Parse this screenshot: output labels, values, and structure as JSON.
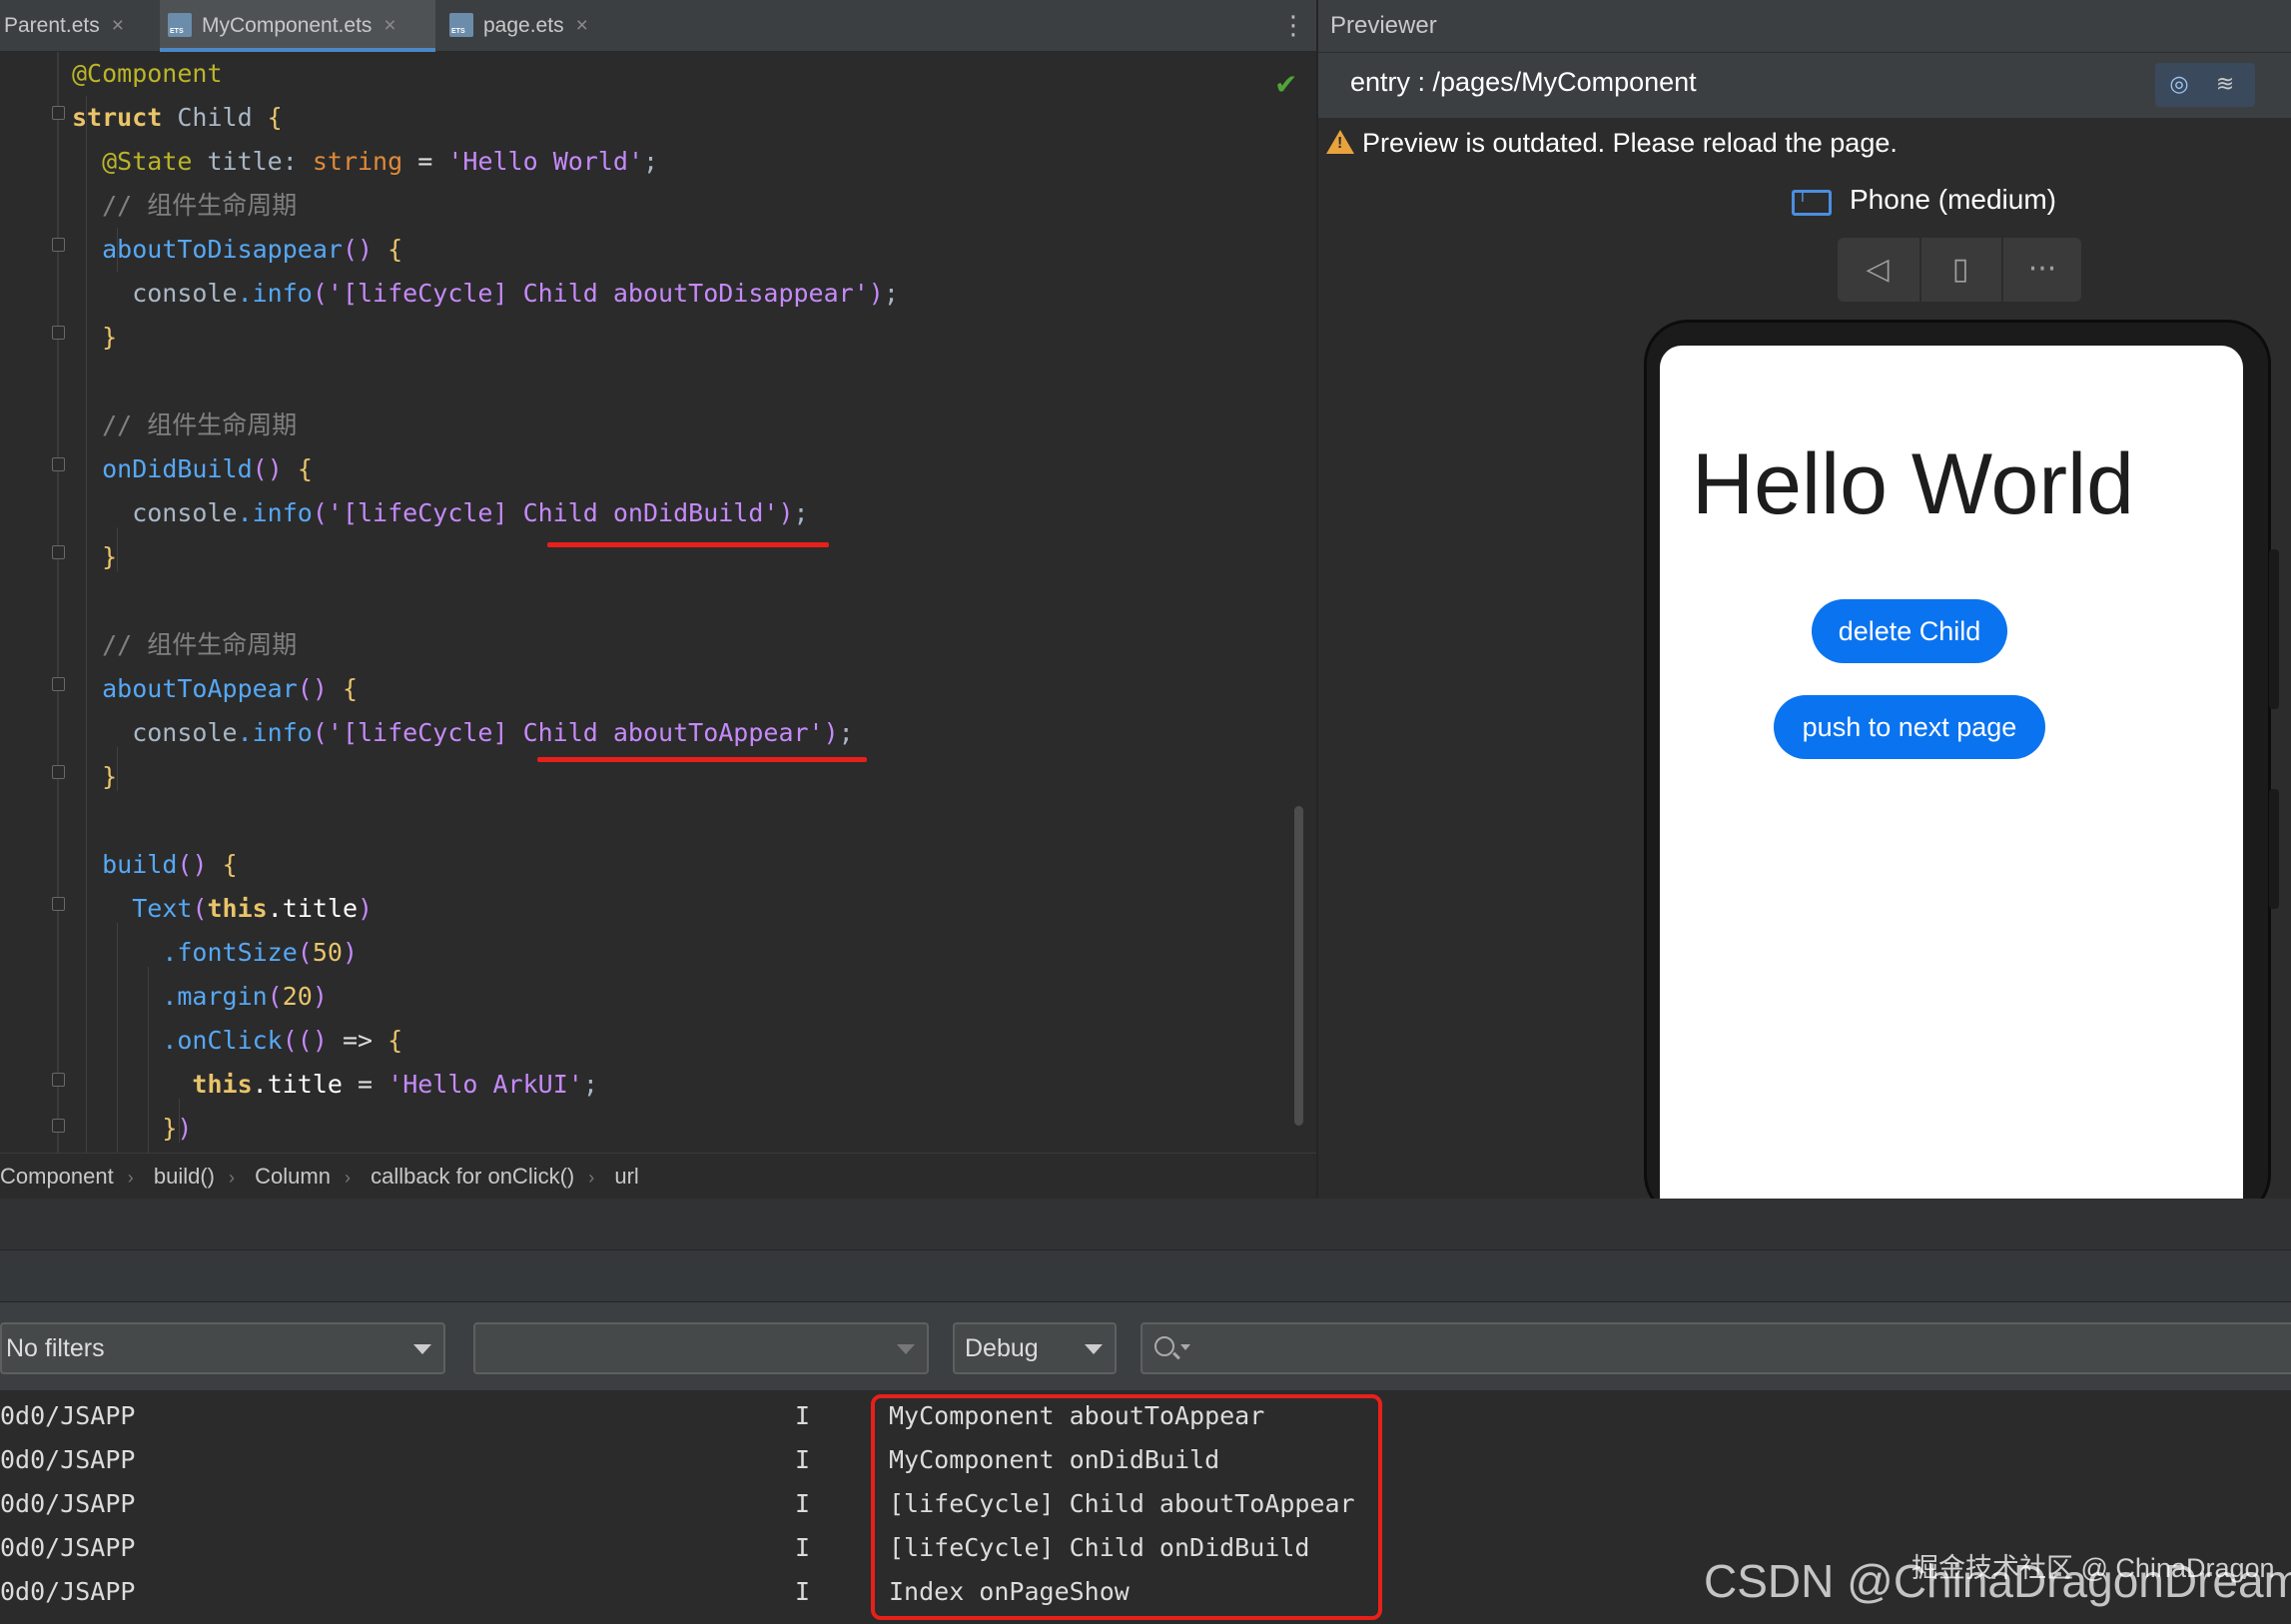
{
  "tabs": [
    {
      "label": "Parent.ets",
      "active": false
    },
    {
      "label": "MyComponent.ets",
      "active": true
    },
    {
      "label": "page.ets",
      "active": false
    }
  ],
  "tab_close_glyph": "×",
  "icons": {
    "kebab": "more-vertical-icon",
    "check": "check-icon",
    "file": "ets-file-icon",
    "warning": "warning-icon",
    "device": "phone-device-icon",
    "back": "triangle-back-icon",
    "rotate": "rotate-device-icon",
    "more": "more-horizontal-icon",
    "search": "search-icon"
  },
  "code_lines": [
    "@Component",
    "struct Child {",
    "  @State title: string = 'Hello World';",
    "  // 组件生命周期",
    "  aboutToDisappear() {",
    "    console.info('[lifeCycle] Child aboutToDisappear');",
    "  }",
    "",
    "  // 组件生命周期",
    "  onDidBuild() {",
    "    console.info('[lifeCycle] Child onDidBuild');",
    "  }",
    "",
    "  // 组件生命周期",
    "  aboutToAppear() {",
    "    console.info('[lifeCycle] Child aboutToAppear');",
    "  }",
    "",
    "  build() {",
    "    Text(this.title)",
    "      .fontSize(50)",
    "      .margin(20)",
    "      .onClick(() => {",
    "        this.title = 'Hello ArkUI';",
    "      })"
  ],
  "breadcrumb": [
    "Component",
    "build()",
    "Column",
    "callback for onClick()",
    "url"
  ],
  "previewer": {
    "title": "Previewer",
    "entry_path": "entry : /pages/MyComponent",
    "warning": "Preview is outdated. Please reload the page.",
    "device": "Phone (medium)",
    "screen": {
      "title": "Hello World",
      "button1": "delete Child",
      "button2": "push to next page"
    }
  },
  "log_filters": {
    "filter": "No filters",
    "process": "",
    "level": "Debug",
    "search": ""
  },
  "log_rows": [
    {
      "tag": "0d0/JSAPP",
      "level": "I",
      "message": "MyComponent aboutToAppear"
    },
    {
      "tag": "0d0/JSAPP",
      "level": "I",
      "message": "MyComponent onDidBuild"
    },
    {
      "tag": "0d0/JSAPP",
      "level": "I",
      "message": "[lifeCycle] Child aboutToAppear"
    },
    {
      "tag": "0d0/JSAPP",
      "level": "I",
      "message": "[lifeCycle] Child onDidBuild"
    },
    {
      "tag": "0d0/JSAPP",
      "level": "I",
      "message": "Index onPageShow"
    }
  ],
  "watermarks": {
    "juejin": "掘金技术社区 @ ChinaDragon",
    "csdn": "CSDN @ChinaDragonDreamer"
  },
  "colors": {
    "accent_blue": "#0a73f0",
    "highlight_red": "#e8201a",
    "warning_orange": "#e8a33d",
    "ok_green": "#4fa53a"
  }
}
